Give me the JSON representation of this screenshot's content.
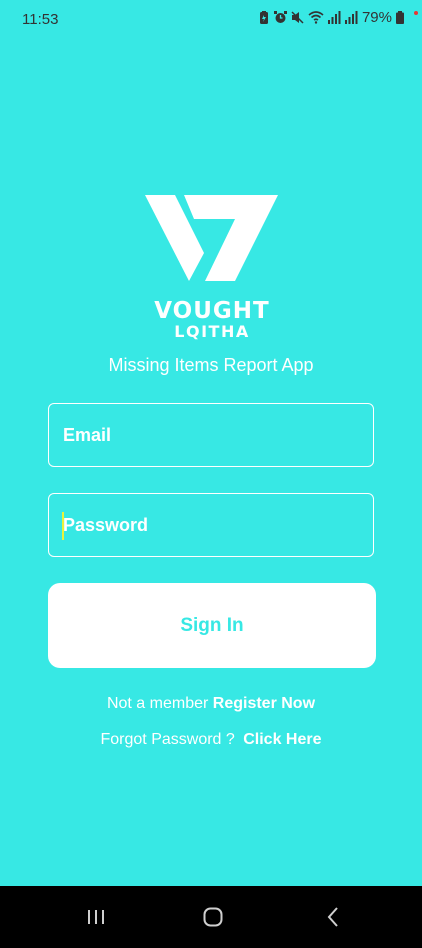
{
  "status_bar": {
    "time": "11:53",
    "battery_percent": "79%",
    "icons": [
      "battery-saver-icon",
      "alarm-icon",
      "mute-icon",
      "wifi-icon",
      "signal-icon",
      "signal-icon-2",
      "battery-icon"
    ]
  },
  "logo": {
    "line1": "VOUGHT",
    "line2": "LQITHA"
  },
  "app_subtitle": "Missing Items Report App",
  "email": {
    "placeholder": "Email",
    "value": ""
  },
  "password": {
    "placeholder": "Password",
    "value": ""
  },
  "signin_button": "Sign In",
  "register": {
    "prompt": "Not a member",
    "link": "Register Now"
  },
  "forgot": {
    "prompt": "Forgot Password ?",
    "link": "Click Here"
  },
  "colors": {
    "background": "#37E8E4",
    "button_bg": "#FFFFFF",
    "button_text": "#37E8E4",
    "text": "#FFFFFF"
  }
}
